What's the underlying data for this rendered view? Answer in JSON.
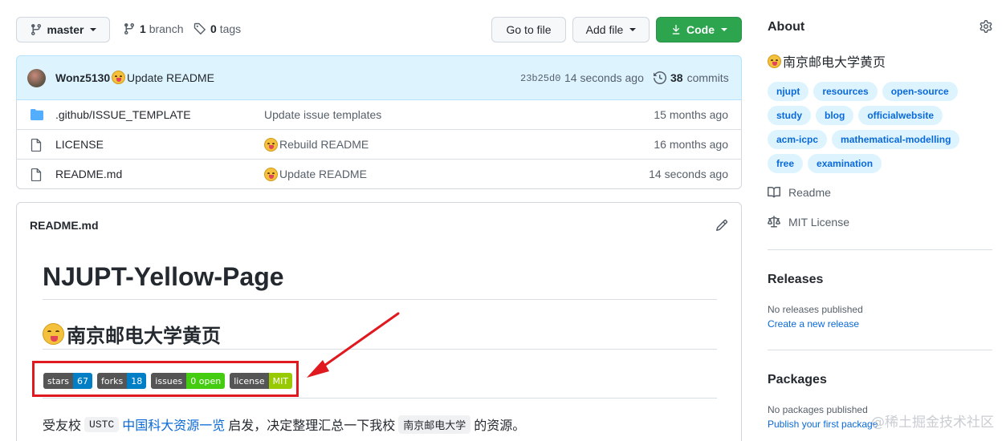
{
  "toolbar": {
    "branch": "master",
    "branch_count": "1",
    "branch_label": "branch",
    "tag_count": "0",
    "tag_label": "tags",
    "go_to_file": "Go to file",
    "add_file": "Add file",
    "code": "Code"
  },
  "commit": {
    "author": "Wonz5130",
    "message": "Update README",
    "hash": "23b25d0",
    "time": "14 seconds ago",
    "count": "38",
    "count_label": "commits"
  },
  "files": [
    {
      "name": ".github/ISSUE_TEMPLATE",
      "message": "Update issue templates",
      "emoji": false,
      "age": "15 months ago",
      "type": "folder"
    },
    {
      "name": "LICENSE",
      "message": "Rebuild README",
      "emoji": true,
      "age": "16 months ago",
      "type": "file"
    },
    {
      "name": "README.md",
      "message": "Update README",
      "emoji": true,
      "age": "14 seconds ago",
      "type": "file"
    }
  ],
  "readme": {
    "filename": "README.md",
    "h1": "NJUPT-Yellow-Page",
    "h2": "南京邮电大学黄页",
    "badges": [
      {
        "label": "stars",
        "value": "67",
        "color": "#007ec6"
      },
      {
        "label": "forks",
        "value": "18",
        "color": "#007ec6"
      },
      {
        "label": "issues",
        "value": "0 open",
        "color": "#4c1"
      },
      {
        "label": "license",
        "value": "MIT",
        "color": "#97ca00"
      }
    ],
    "para": {
      "prefix": "受友校",
      "code1": "USTC",
      "link": "中国科大资源一览",
      "middle": "启发，决定整理汇总一下我校",
      "code2": "南京邮电大学",
      "suffix": "的资源。"
    }
  },
  "about": {
    "title": "About",
    "description": "南京邮电大学黄页",
    "topics": [
      "njupt",
      "resources",
      "open-source",
      "study",
      "blog",
      "officialwebsite",
      "acm-icpc",
      "mathematical-modelling",
      "free",
      "examination"
    ],
    "readme_link": "Readme",
    "license_link": "MIT License"
  },
  "releases": {
    "title": "Releases",
    "empty": "No releases published",
    "create": "Create a new release"
  },
  "packages": {
    "title": "Packages",
    "empty": "No packages published",
    "publish": "Publish your first package"
  },
  "watermark": "@稀土掘金技术社区",
  "colors": {
    "accent": "#0969da",
    "code_button": "#2da44e",
    "highlight": "#e0181f"
  }
}
